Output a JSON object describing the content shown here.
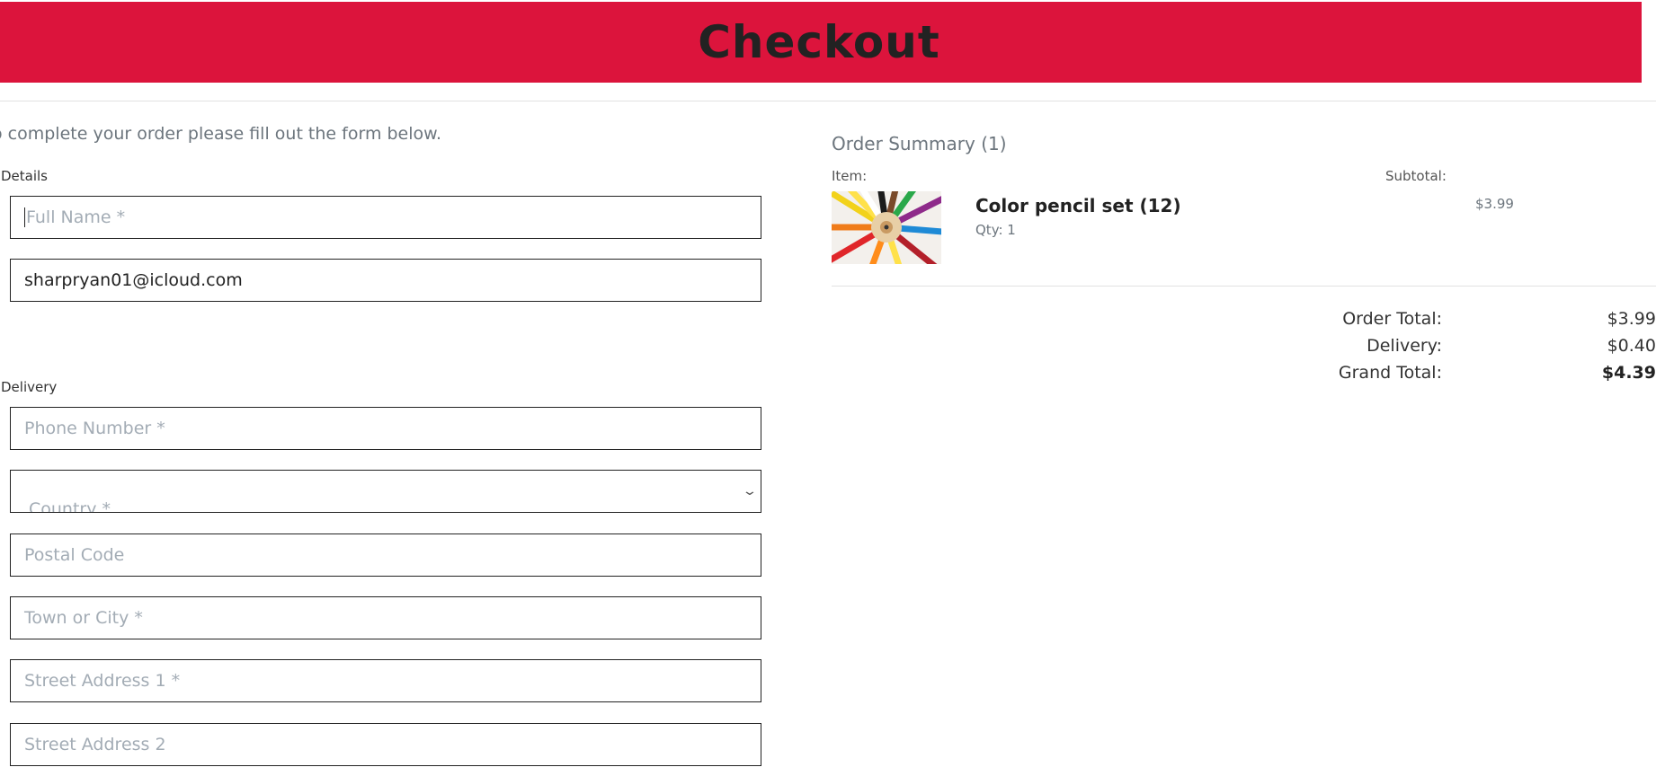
{
  "header": {
    "title": "Checkout",
    "bg_color": "#dc143c"
  },
  "form": {
    "intro": "o complete your order please fill out the form below.",
    "details_label": "Details",
    "full_name_placeholder": "Full Name *",
    "email_value": "sharpryan01@icloud.com",
    "delivery_label": "Delivery",
    "phone_placeholder": "Phone Number *",
    "country_placeholder": "Country *",
    "postal_placeholder": "Postal Code",
    "town_placeholder": "Town or City *",
    "street1_placeholder": "Street Address 1 *",
    "street2_placeholder": "Street Address 2"
  },
  "summary": {
    "title": "Order Summary (1)",
    "item_header": "Item:",
    "subtotal_header": "Subtotal:",
    "items": [
      {
        "name": "Color pencil set (12)",
        "qty": "Qty: 1",
        "subtotal": "$3.99",
        "image_icon": "color-pencils-image"
      }
    ],
    "order_total_label": "Order Total:",
    "order_total_value": "$3.99",
    "delivery_label": "Delivery:",
    "delivery_value": "$0.40",
    "grand_total_label": "Grand Total:",
    "grand_total_value": "$4.39"
  }
}
